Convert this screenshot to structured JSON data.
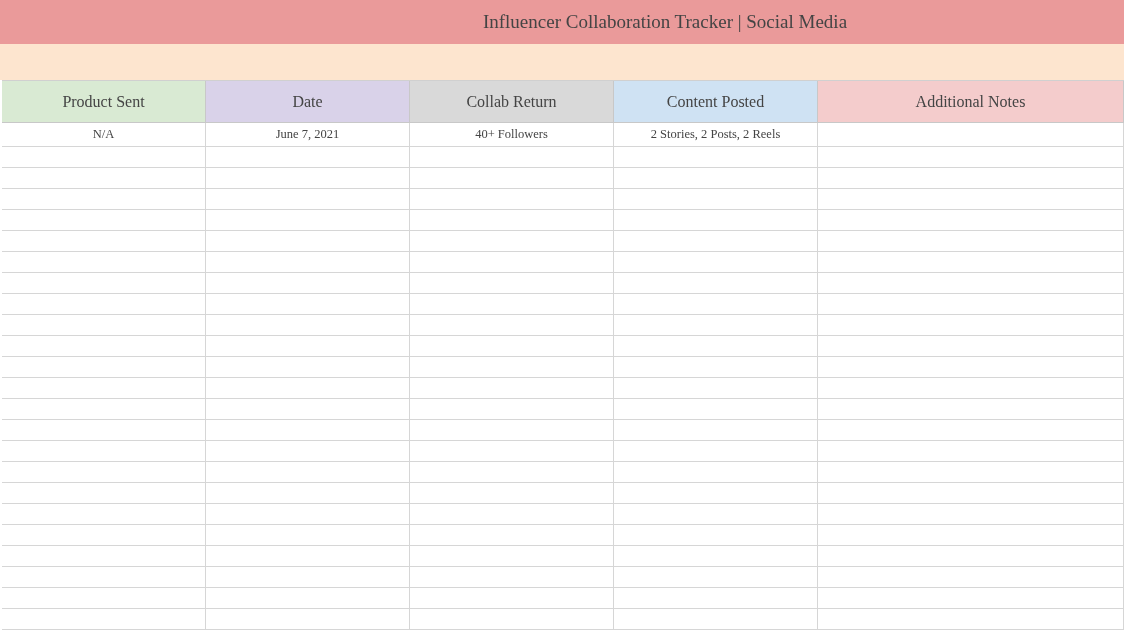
{
  "title": "Influencer Collaboration Tracker | Social Media",
  "table": {
    "columns": [
      {
        "label": "Product Sent",
        "color": "#d9ead3"
      },
      {
        "label": "Date",
        "color": "#d9d2e9"
      },
      {
        "label": "Collab Return",
        "color": "#d9d9d9"
      },
      {
        "label": "Content Posted",
        "color": "#cfe2f3"
      },
      {
        "label": "Additional Notes",
        "color": "#f4cccc"
      }
    ],
    "rows": [
      [
        "N/A",
        "June 7, 2021",
        "40+ Followers",
        "2 Stories, 2 Posts, 2 Reels"
      ]
    ]
  }
}
